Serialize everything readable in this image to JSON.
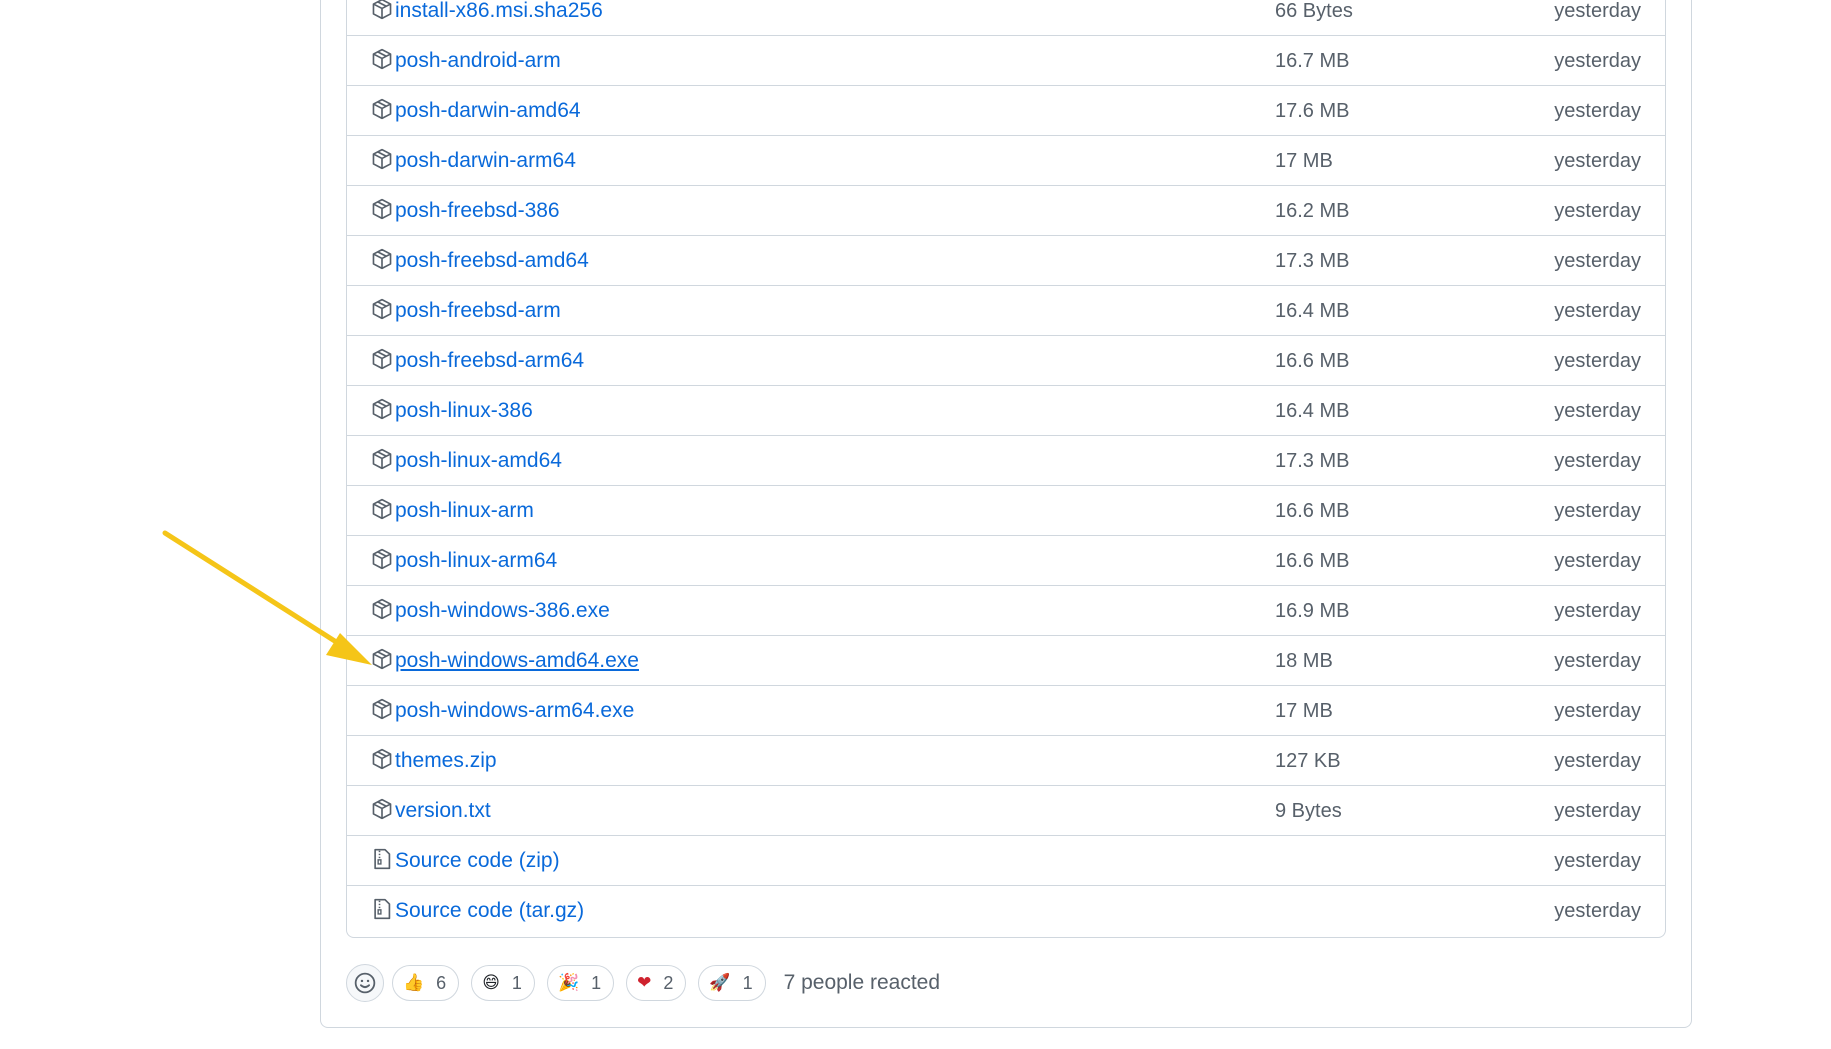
{
  "assets": [
    {
      "name": "install-x86.msi.sha256",
      "size": "66 Bytes",
      "date": "yesterday",
      "icon": "package-icon"
    },
    {
      "name": "posh-android-arm",
      "size": "16.7 MB",
      "date": "yesterday",
      "icon": "package-icon"
    },
    {
      "name": "posh-darwin-amd64",
      "size": "17.6 MB",
      "date": "yesterday",
      "icon": "package-icon"
    },
    {
      "name": "posh-darwin-arm64",
      "size": "17 MB",
      "date": "yesterday",
      "icon": "package-icon"
    },
    {
      "name": "posh-freebsd-386",
      "size": "16.2 MB",
      "date": "yesterday",
      "icon": "package-icon"
    },
    {
      "name": "posh-freebsd-amd64",
      "size": "17.3 MB",
      "date": "yesterday",
      "icon": "package-icon"
    },
    {
      "name": "posh-freebsd-arm",
      "size": "16.4 MB",
      "date": "yesterday",
      "icon": "package-icon"
    },
    {
      "name": "posh-freebsd-arm64",
      "size": "16.6 MB",
      "date": "yesterday",
      "icon": "package-icon"
    },
    {
      "name": "posh-linux-386",
      "size": "16.4 MB",
      "date": "yesterday",
      "icon": "package-icon"
    },
    {
      "name": "posh-linux-amd64",
      "size": "17.3 MB",
      "date": "yesterday",
      "icon": "package-icon"
    },
    {
      "name": "posh-linux-arm",
      "size": "16.6 MB",
      "date": "yesterday",
      "icon": "package-icon"
    },
    {
      "name": "posh-linux-arm64",
      "size": "16.6 MB",
      "date": "yesterday",
      "icon": "package-icon"
    },
    {
      "name": "posh-windows-386.exe",
      "size": "16.9 MB",
      "date": "yesterday",
      "icon": "package-icon"
    },
    {
      "name": "posh-windows-amd64.exe",
      "size": "18 MB",
      "date": "yesterday",
      "icon": "package-icon",
      "hovered": true
    },
    {
      "name": "posh-windows-arm64.exe",
      "size": "17 MB",
      "date": "yesterday",
      "icon": "package-icon"
    },
    {
      "name": "themes.zip",
      "size": "127 KB",
      "date": "yesterday",
      "icon": "package-icon"
    },
    {
      "name": "version.txt",
      "size": "9 Bytes",
      "date": "yesterday",
      "icon": "package-icon"
    },
    {
      "name": "Source code",
      "suffix": "(zip)",
      "size": "",
      "date": "yesterday",
      "icon": "file-zip-icon"
    },
    {
      "name": "Source code",
      "suffix": "(tar.gz)",
      "size": "",
      "date": "yesterday",
      "icon": "file-zip-icon"
    }
  ],
  "reactions": [
    {
      "emoji": "👍",
      "name": "thumbs-up",
      "count": "6"
    },
    {
      "emoji": "😄",
      "name": "laugh",
      "count": "1"
    },
    {
      "emoji": "🎉",
      "name": "hooray",
      "count": "1"
    },
    {
      "emoji": "❤",
      "name": "heart",
      "count": "2"
    },
    {
      "emoji": "🚀",
      "name": "rocket",
      "count": "1"
    }
  ],
  "reactions_summary": "7 people reacted",
  "colors": {
    "link": "#0969da",
    "muted": "#57606a",
    "border": "#d0d7de",
    "annotation_arrow": "#f5c518",
    "heart": "#cf222e"
  }
}
